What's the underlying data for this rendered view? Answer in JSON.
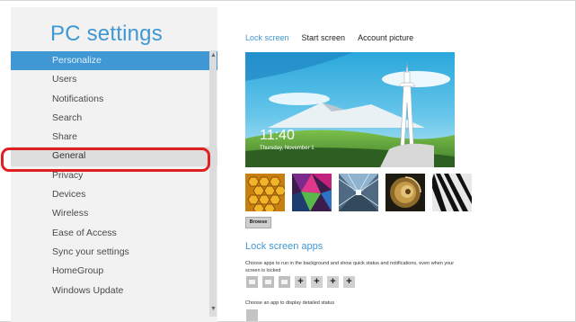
{
  "app": {
    "title": "PC settings"
  },
  "nav": {
    "items": [
      {
        "label": "Personalize",
        "state": "selected"
      },
      {
        "label": "Users",
        "state": ""
      },
      {
        "label": "Notifications",
        "state": ""
      },
      {
        "label": "Search",
        "state": ""
      },
      {
        "label": "Share",
        "state": ""
      },
      {
        "label": "General",
        "state": "hover"
      },
      {
        "label": "Privacy",
        "state": ""
      },
      {
        "label": "Devices",
        "state": ""
      },
      {
        "label": "Wireless",
        "state": ""
      },
      {
        "label": "Ease of Access",
        "state": ""
      },
      {
        "label": "Sync your settings",
        "state": ""
      },
      {
        "label": "HomeGroup",
        "state": ""
      },
      {
        "label": "Windows Update",
        "state": ""
      }
    ]
  },
  "tabs": [
    {
      "label": "Lock screen",
      "active": true
    },
    {
      "label": "Start screen",
      "active": false
    },
    {
      "label": "Account picture",
      "active": false
    }
  ],
  "lock_preview": {
    "time": "11:40",
    "date": "Thursday, November 1"
  },
  "thumbnails": [
    {
      "icon": "honeycomb-thumbnail"
    },
    {
      "icon": "prism-thumbnail"
    },
    {
      "icon": "tunnel-thumbnail"
    },
    {
      "icon": "nautilus-thumbnail"
    },
    {
      "icon": "piano-thumbnail"
    }
  ],
  "browse": {
    "label": "Browse"
  },
  "lock_screen_apps": {
    "title": "Lock screen apps",
    "description": "Choose apps to run in the background and show quick status and notifications, even when your screen is locked",
    "slots": [
      {
        "icon": "messaging-icon"
      },
      {
        "icon": "mail-icon"
      },
      {
        "icon": "calendar-icon"
      },
      {
        "icon": "plus-icon",
        "label": "+"
      },
      {
        "icon": "plus-icon",
        "label": "+"
      },
      {
        "icon": "plus-icon",
        "label": "+"
      },
      {
        "icon": "plus-icon",
        "label": "+"
      }
    ],
    "detail_description": "Choose an app to display detailed status"
  },
  "colors": {
    "accent": "#3f97d3",
    "highlight_ring": "#e02020"
  }
}
